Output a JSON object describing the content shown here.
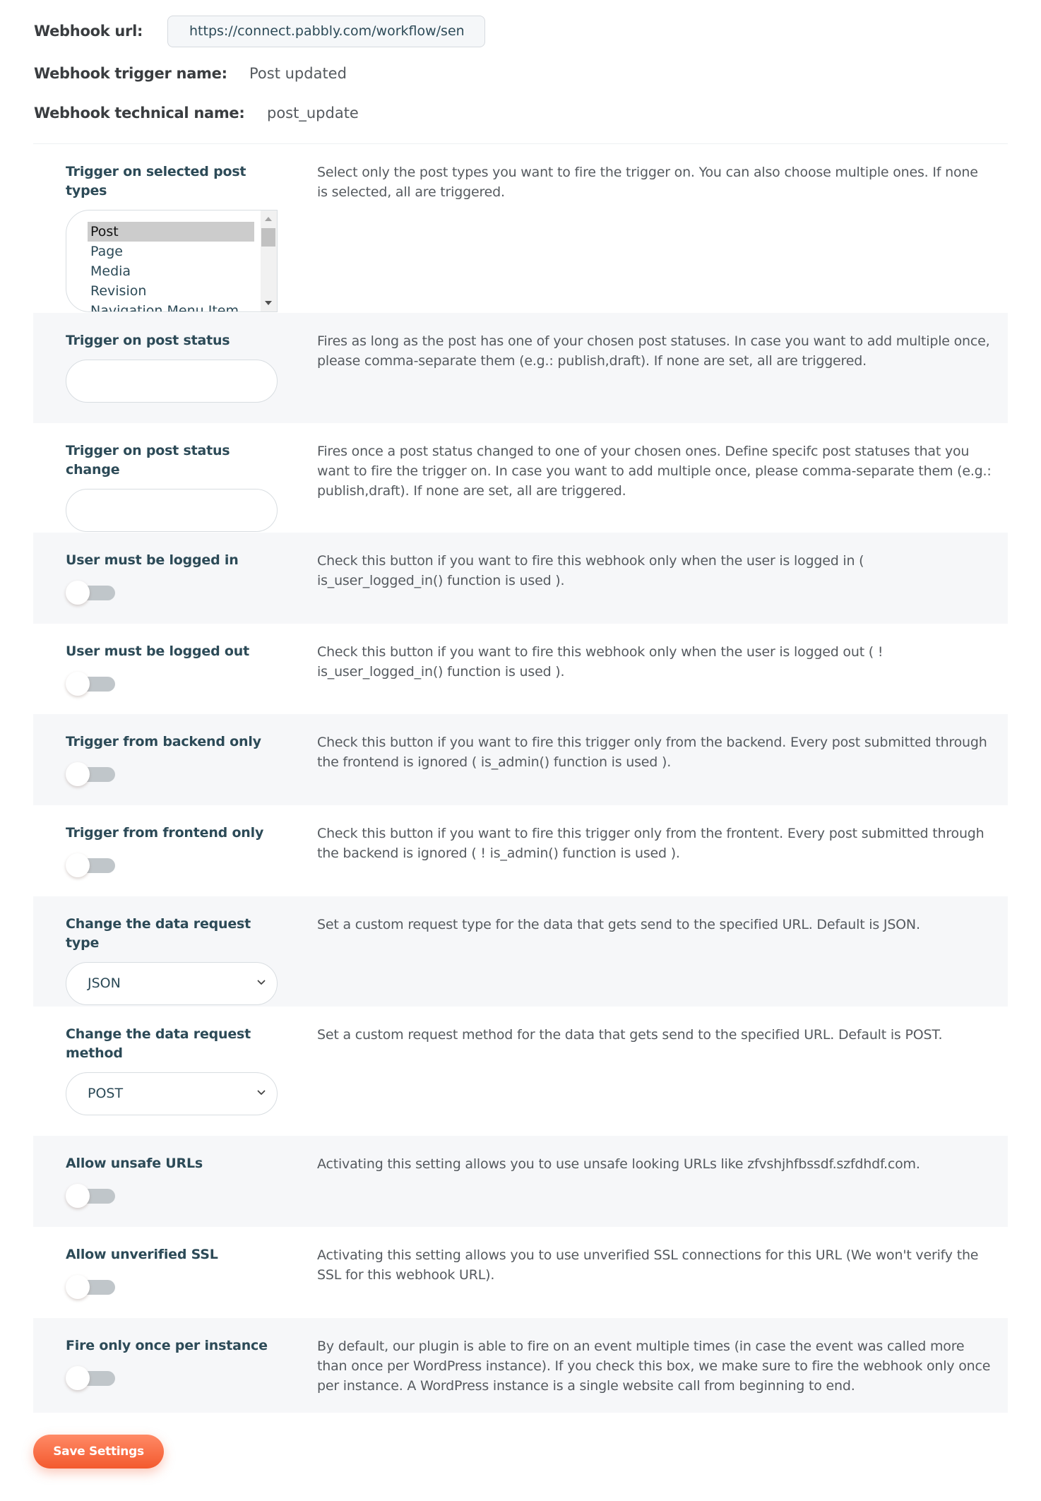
{
  "header": {
    "webhook_url_label": "Webhook url:",
    "webhook_url_value": "https://connect.pabbly.com/workflow/sendwebhookdata/",
    "trigger_name_label": "Webhook trigger name:",
    "trigger_name_value": "Post updated",
    "technical_name_label": "Webhook technical name:",
    "technical_name_value": "post_update"
  },
  "settings": {
    "post_types": {
      "label": "Trigger on selected post types",
      "description": "Select only the post types you want to fire the trigger on. You can also choose multiple ones. If none is selected, all are triggered.",
      "options": [
        "Post",
        "Page",
        "Media",
        "Revision",
        "Navigation Menu Item"
      ],
      "selected": "Post"
    },
    "post_status": {
      "label": "Trigger on post status",
      "description": "Fires as long as the post has one of your chosen post statuses. In case you want to add multiple once, please comma-separate them (e.g.: publish,draft). If none are set, all are triggered.",
      "value": ""
    },
    "post_status_change": {
      "label": "Trigger on post status change",
      "description": "Fires once a post status changed to one of your chosen ones. Define specifc post statuses that you want to fire the trigger on. In case you want to add multiple once, please comma-separate them (e.g.: publish,draft). If none are set, all are triggered.",
      "value": ""
    },
    "logged_in": {
      "label": "User must be logged in",
      "description": "Check this button if you want to fire this webhook only when the user is logged in ( is_user_logged_in() function is used ).",
      "enabled": false
    },
    "logged_out": {
      "label": "User must be logged out",
      "description": "Check this button if you want to fire this webhook only when the user is logged out ( ! is_user_logged_in() function is used ).",
      "enabled": false
    },
    "backend_only": {
      "label": "Trigger from backend only",
      "description": "Check this button if you want to fire this trigger only from the backend. Every post submitted through the frontend is ignored ( is_admin() function is used ).",
      "enabled": false
    },
    "frontend_only": {
      "label": "Trigger from frontend only",
      "description": "Check this button if you want to fire this trigger only from the frontent. Every post submitted through the backend is ignored ( ! is_admin() function is used ).",
      "enabled": false
    },
    "request_type": {
      "label": "Change the data request type",
      "description": "Set a custom request type for the data that gets send to the specified URL. Default is JSON.",
      "value": "JSON"
    },
    "request_method": {
      "label": "Change the data request method",
      "description": "Set a custom request method for the data that gets send to the specified URL. Default is POST.",
      "value": "POST"
    },
    "unsafe_urls": {
      "label": "Allow unsafe URLs",
      "description": "Activating this setting allows you to use unsafe looking URLs like zfvshjhfbssdf.szfdhdf.com.",
      "enabled": false
    },
    "unverified_ssl": {
      "label": "Allow unverified SSL",
      "description": "Activating this setting allows you to use unverified SSL connections for this URL (We won't verify the SSL for this webhook URL).",
      "enabled": false
    },
    "fire_once": {
      "label": "Fire only once per instance",
      "description": "By default, our plugin is able to fire on an event multiple times (in case the event was called more than once per WordPress instance). If you check this box, we make sure to fire the webhook only once per instance. A WordPress instance is a single website call from beginning to end.",
      "enabled": false
    }
  },
  "actions": {
    "save_label": "Save Settings"
  },
  "colors": {
    "accent": "#f35a2e",
    "label": "#2c4a57",
    "shaded_row": "#f6f7f9",
    "toggle_off": "#c0c6ca"
  }
}
